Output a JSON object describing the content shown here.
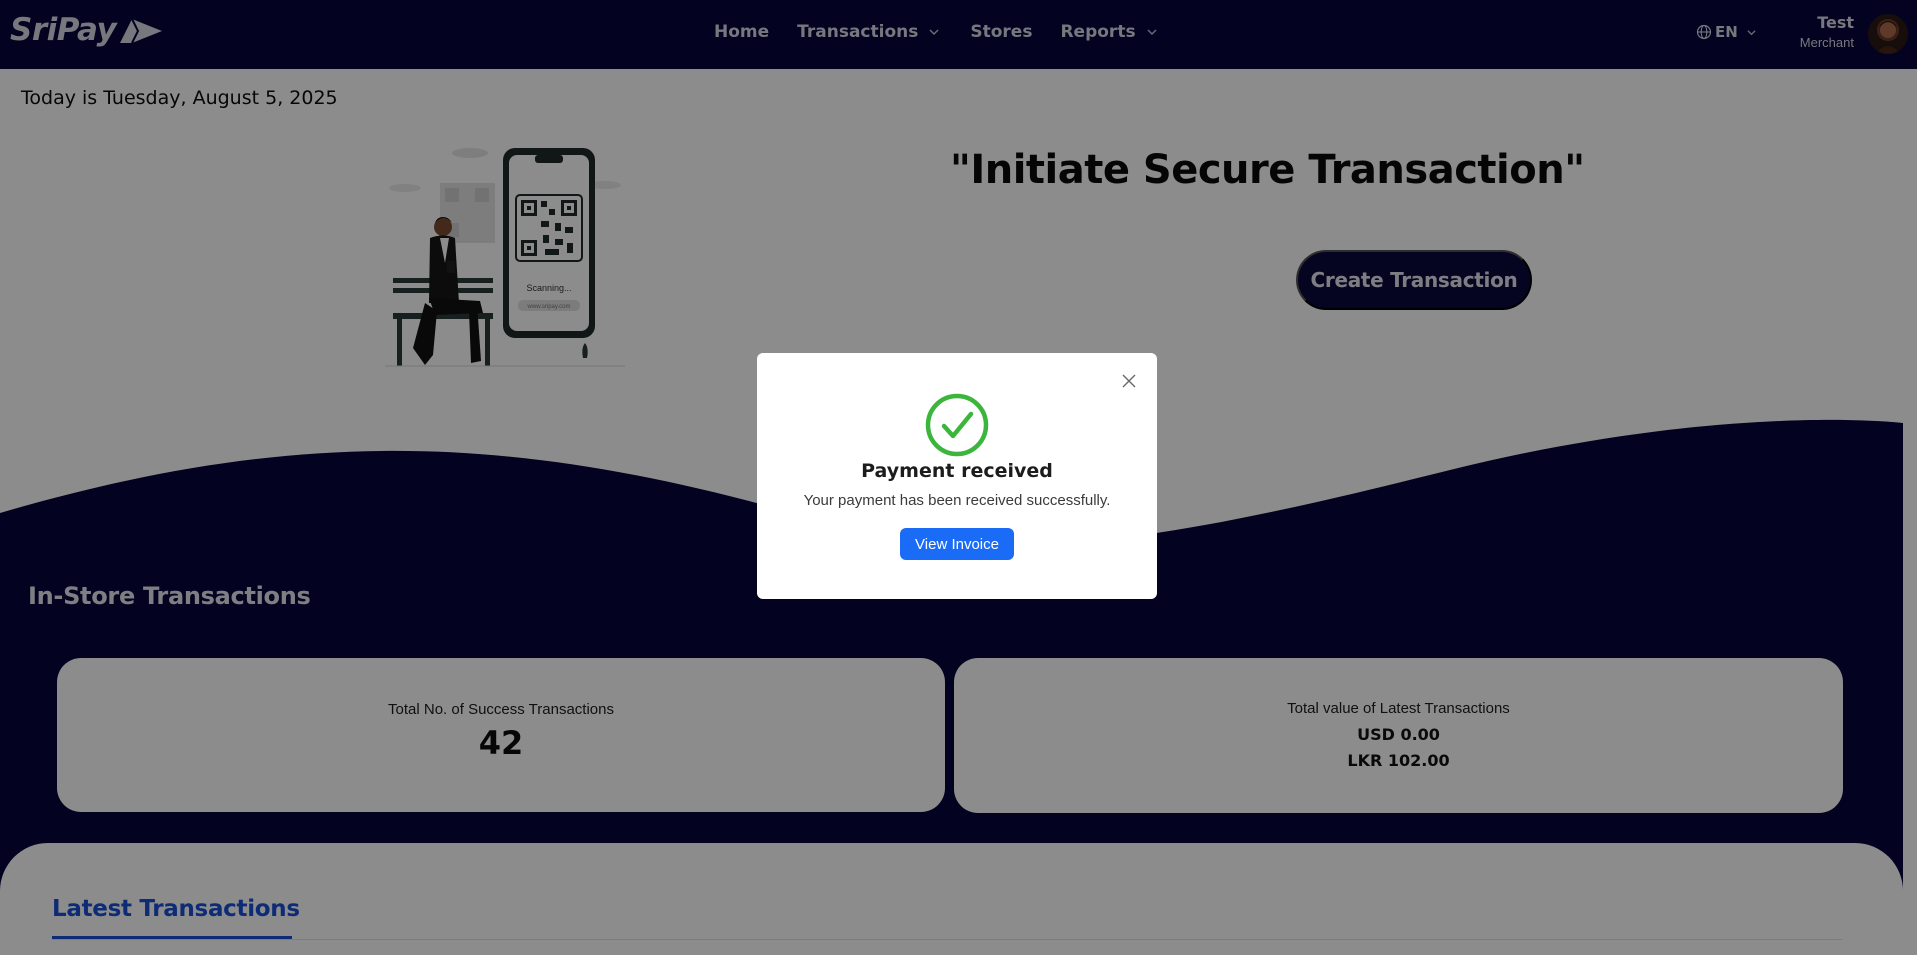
{
  "brand": {
    "name": "SriPay"
  },
  "nav": {
    "home": "Home",
    "transactions": "Transactions",
    "stores": "Stores",
    "reports": "Reports"
  },
  "language": {
    "current": "EN"
  },
  "user": {
    "name": "Test",
    "role": "Merchant"
  },
  "page": {
    "date_text": "Today is Tuesday, August 5, 2025",
    "hero_title": "\"Initiate Secure Transaction\"",
    "create_button": "Create Transaction",
    "illustration_text": {
      "scanning": "Scanning...",
      "url": "www.sripay.com"
    }
  },
  "in_store": {
    "title": "In-Store Transactions",
    "success_label": "Total No. of Success Transactions",
    "success_count": "42",
    "value_label": "Total value of Latest Transactions",
    "values": [
      "USD 0.00",
      "LKR 102.00"
    ]
  },
  "latest": {
    "tab_label": "Latest Transactions"
  },
  "modal": {
    "title": "Payment received",
    "message": "Your payment has been received successfully.",
    "button": "View Invoice"
  },
  "colors": {
    "navy": "#06053d",
    "accent_blue": "#1a50d8",
    "invoice_blue": "#1a6bf5",
    "success_green": "#3bb53b"
  },
  "icons": {
    "logo": "sripay-arrow-logo",
    "transactions_chevron": "chevron-down-icon",
    "reports_chevron": "chevron-down-icon",
    "language": "globe-icon",
    "modal_close": "close-icon",
    "modal_status": "check-circle-icon"
  }
}
